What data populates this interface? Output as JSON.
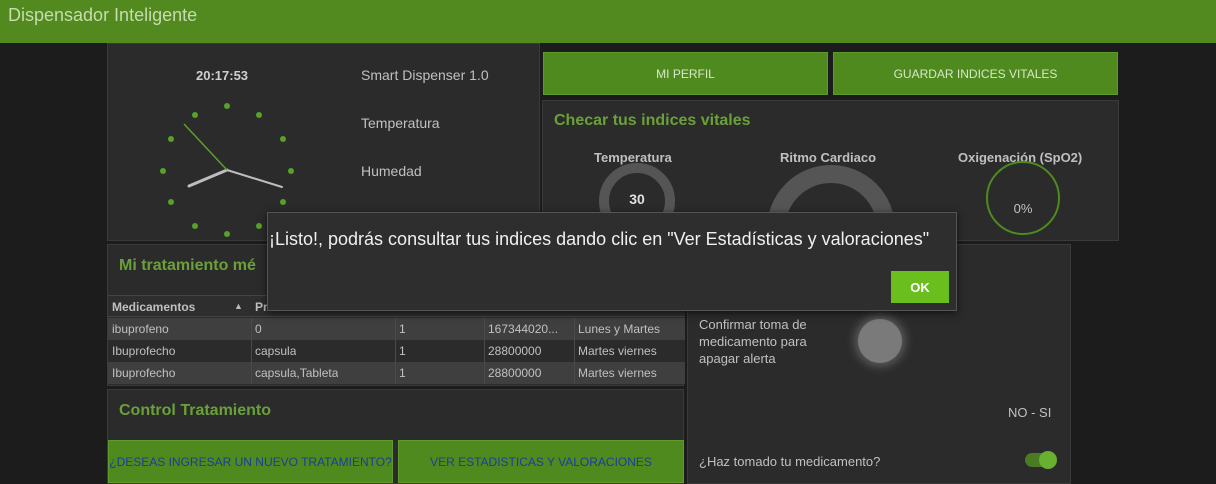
{
  "app": {
    "title": "Dispensador Inteligente"
  },
  "clock": {
    "time": "20:17:53",
    "device": "Smart Dispenser 1.0",
    "temperature_label": "Temperatura",
    "humidity_label": "Humedad"
  },
  "top_buttons": {
    "profile": "MI PERFIL",
    "save_vitals": "GUARDAR INDICES VITALES"
  },
  "vitals": {
    "title": "Checar tus indices vitales",
    "temperature_label": "Temperatura",
    "temperature_value": "30",
    "heart_label": "Ritmo Cardiaco",
    "oxygen_label": "Oxigenación (SpO2)",
    "oxygen_value": "0%"
  },
  "treatment": {
    "title": "Mi tratamiento mé",
    "columns": [
      "Medicamentos",
      "Pr",
      "",
      "",
      ""
    ],
    "rows": [
      [
        "ibuprofeno",
        "0",
        "1",
        "167344020...",
        "Lunes y Martes"
      ],
      [
        "Ibuprofecho",
        "capsula",
        "1",
        "28800000",
        "Martes viernes"
      ],
      [
        "Ibuprofecho",
        "capsula,Tableta",
        "1",
        "28800000",
        "Martes viernes"
      ]
    ]
  },
  "control": {
    "title": "Control Tratamiento",
    "new_treatment": "¿DESEAS INGRESAR UN NUEVO TRATAMIENTO?",
    "stats": "VER ESTADISTICAS Y VALORACIONES"
  },
  "alert": {
    "confirm_text": "Confirmar toma de medicamento para apagar alerta",
    "no_si": "NO - SI",
    "taken_question": "¿Haz tomado tu medicamento?"
  },
  "modal": {
    "message": "¡Listo!, podrás consultar tus indices dando clic en \"Ver Estadísticas y valoraciones\"",
    "ok_label": "OK"
  }
}
